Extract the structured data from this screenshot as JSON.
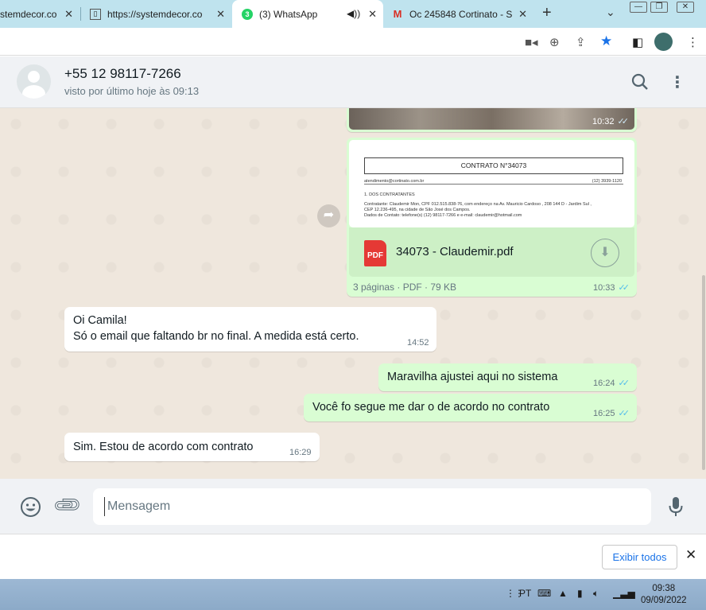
{
  "browser": {
    "tabs": [
      {
        "label": "stemdecor.co",
        "favicon": "page-icon"
      },
      {
        "label": "https://systemdecor.co",
        "favicon": "page-icon"
      },
      {
        "label": "(3) WhatsApp",
        "favicon": "whatsapp-icon",
        "badge": "3",
        "active": true
      },
      {
        "label": "Oc 245848 Cortinato - S",
        "favicon": "gmail-icon"
      }
    ],
    "new_tab": "+",
    "tab_search": "⌄"
  },
  "header": {
    "name": "+55 12 98117-7266",
    "status": "visto por último hoje às 09:13"
  },
  "messages": {
    "image": {
      "time": "10:32"
    },
    "document": {
      "preview_title": "CONTRATO N°34073",
      "preview_email": "atendimento@cortinato.com.br",
      "preview_phone": "(12) 3939-1120",
      "preview_section": "1. DOS CONTRATANTES",
      "preview_line1": "Contratante: Claudemir Mon, CPF 012.515.838-76, com endereço na Av. Mauricio Cardoso , 208 144 D - Jardim Sul ,",
      "preview_line2": "CEP 12.236-495, na cidade de São José dos Campos.",
      "preview_line3": "Dados de Contato: telefone(s) (12) 98117-7266 e e-mail: claudemir@hotmail.com",
      "icon_label": "PDF",
      "filename": "34073 - Claudemir.pdf",
      "meta": "3 páginas · PDF · 79 KB",
      "time": "10:33"
    },
    "in1": {
      "line1": "Oi Camila!",
      "line2": "Só o email que faltando br no final. A medida está certo.",
      "time": "14:52"
    },
    "out1": {
      "text": "Maravilha ajustei aqui no sistema",
      "time": "16:24"
    },
    "out2": {
      "text": "Você fo segue me dar o de acordo no contrato",
      "time": "16:25"
    },
    "in2": {
      "text": "Sim. Estou de acordo com contrato",
      "time": "16:29"
    }
  },
  "composer": {
    "placeholder": "Mensagem"
  },
  "downloads": {
    "show_all": "Exibir todos"
  },
  "taskbar": {
    "lang": "PT",
    "time": "09:38",
    "date": "09/09/2022"
  },
  "colors": {
    "outgoing": "#d9fdd3",
    "incoming": "#ffffff",
    "chat_bg": "#efe7dd",
    "read_ticks": "#53bdeb"
  }
}
